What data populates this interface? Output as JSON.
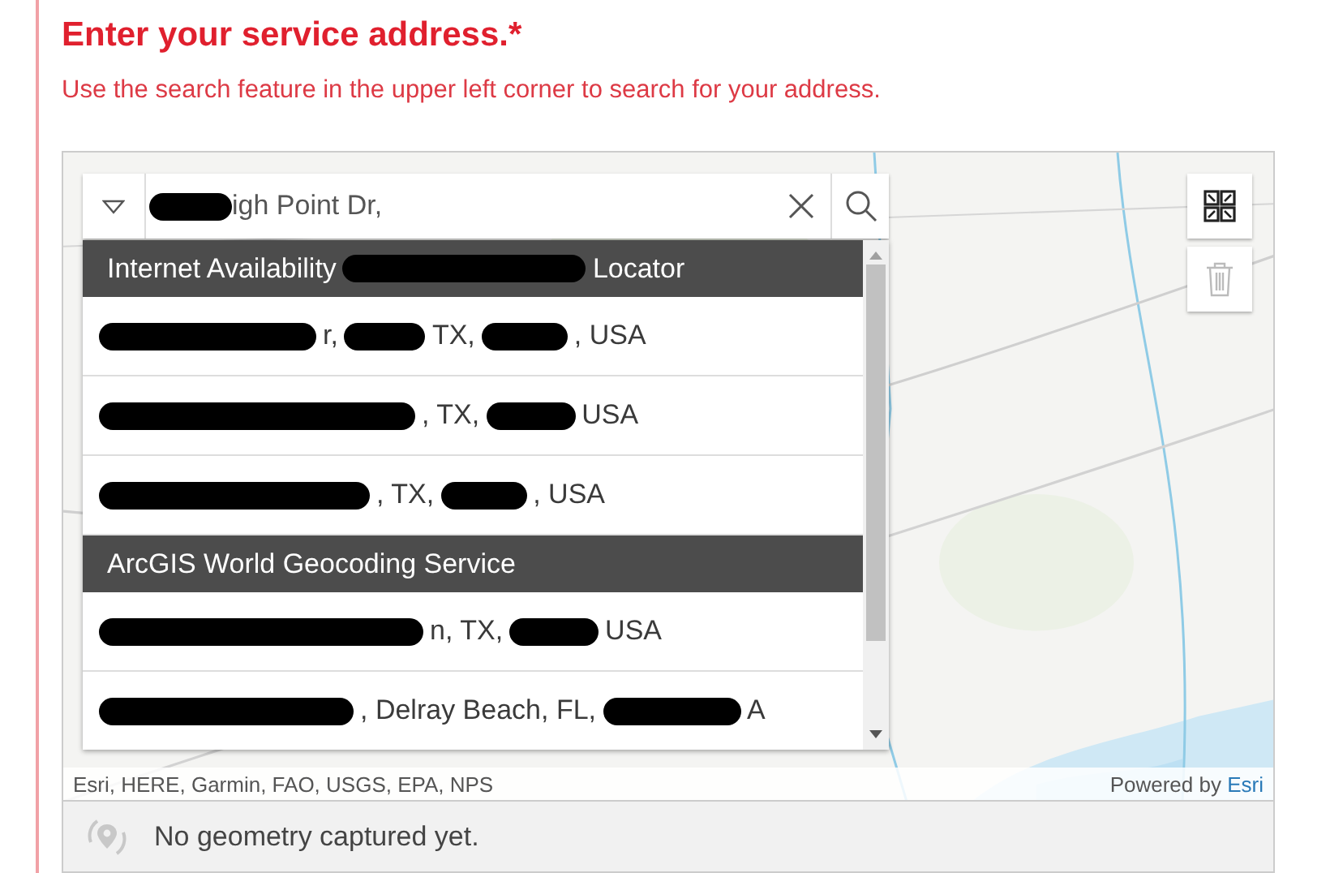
{
  "heading": {
    "title": "Enter your service address.",
    "required_mark": "*",
    "hint": "Use the search feature in the upper left corner to search for your address."
  },
  "search": {
    "value_parts": [
      {
        "kind": "redacted"
      },
      {
        "kind": "text",
        "text": "igh Point Dr,"
      }
    ]
  },
  "suggestions": [
    {
      "kind": "group",
      "parts": [
        {
          "kind": "text",
          "text": "Internet Availability"
        },
        {
          "kind": "redacted"
        },
        {
          "kind": "text",
          "text": "Locator"
        }
      ]
    },
    {
      "kind": "result",
      "parts": [
        {
          "kind": "redacted"
        },
        {
          "kind": "text",
          "text": "r,"
        },
        {
          "kind": "redacted"
        },
        {
          "kind": "text",
          "text": "TX,"
        },
        {
          "kind": "redacted"
        },
        {
          "kind": "text",
          "text": ", USA"
        }
      ]
    },
    {
      "kind": "result",
      "parts": [
        {
          "kind": "redacted"
        },
        {
          "kind": "text",
          "text": ", TX,"
        },
        {
          "kind": "redacted"
        },
        {
          "kind": "text",
          "text": "USA"
        }
      ]
    },
    {
      "kind": "result",
      "parts": [
        {
          "kind": "redacted"
        },
        {
          "kind": "text",
          "text": ", TX,"
        },
        {
          "kind": "redacted"
        },
        {
          "kind": "text",
          "text": ", USA"
        }
      ]
    },
    {
      "kind": "group",
      "parts": [
        {
          "kind": "text",
          "text": "ArcGIS World Geocoding Service"
        }
      ]
    },
    {
      "kind": "result",
      "parts": [
        {
          "kind": "redacted"
        },
        {
          "kind": "text",
          "text": "n, TX,"
        },
        {
          "kind": "redacted"
        },
        {
          "kind": "text",
          "text": "USA"
        }
      ]
    },
    {
      "kind": "result",
      "parts": [
        {
          "kind": "redacted"
        },
        {
          "kind": "text",
          "text": ", Delray Beach, FL,"
        },
        {
          "kind": "redacted"
        },
        {
          "kind": "text",
          "text": "A"
        }
      ]
    }
  ],
  "attribution": {
    "sources": "Esri, HERE, Garmin, FAO, USGS, EPA, NPS",
    "powered_by": "Powered by",
    "link": "Esri"
  },
  "status": {
    "message": "No geometry captured yet."
  }
}
